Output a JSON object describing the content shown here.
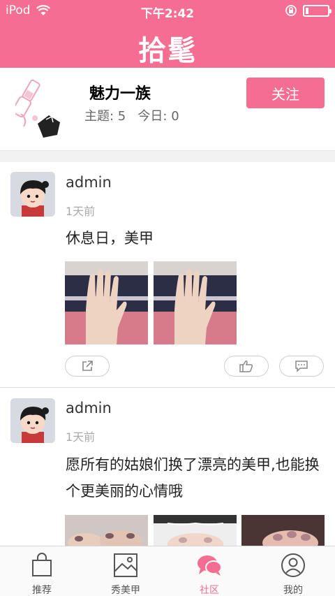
{
  "status_bar": {
    "carrier": "iPod",
    "time": "下午2:42"
  },
  "header": {
    "title": "拾髦"
  },
  "board": {
    "name": "魅力一族",
    "topics_label": "主题: 5",
    "today_label": "今日: 0",
    "follow_label": "关注",
    "logo_icon": "nail-polish-icon"
  },
  "posts": [
    {
      "author": "admin",
      "time": "1天前",
      "text": "休息日，美甲",
      "images": [
        "hand-photo",
        "hand-photo"
      ]
    },
    {
      "author": "admin",
      "time": "1天前",
      "text": "愿所有的姑娘们换了漂亮的美甲,也能换个更美丽的心情哦",
      "images": [
        "nail-photo",
        "nail-photo",
        "nail-photo"
      ]
    }
  ],
  "actions": {
    "share_icon": "share-icon",
    "like_icon": "thumbs-up-icon",
    "comment_icon": "comment-icon"
  },
  "tabs": [
    {
      "label": "推荐",
      "icon": "shopping-bag-icon",
      "active": false
    },
    {
      "label": "秀美甲",
      "icon": "image-icon",
      "active": false
    },
    {
      "label": "社区",
      "icon": "chat-bubbles-icon",
      "active": true
    },
    {
      "label": "我的",
      "icon": "user-icon",
      "active": false
    }
  ],
  "colors": {
    "accent": "#f56e91",
    "background": "#ffffff",
    "separator": "#f2f2f2"
  }
}
